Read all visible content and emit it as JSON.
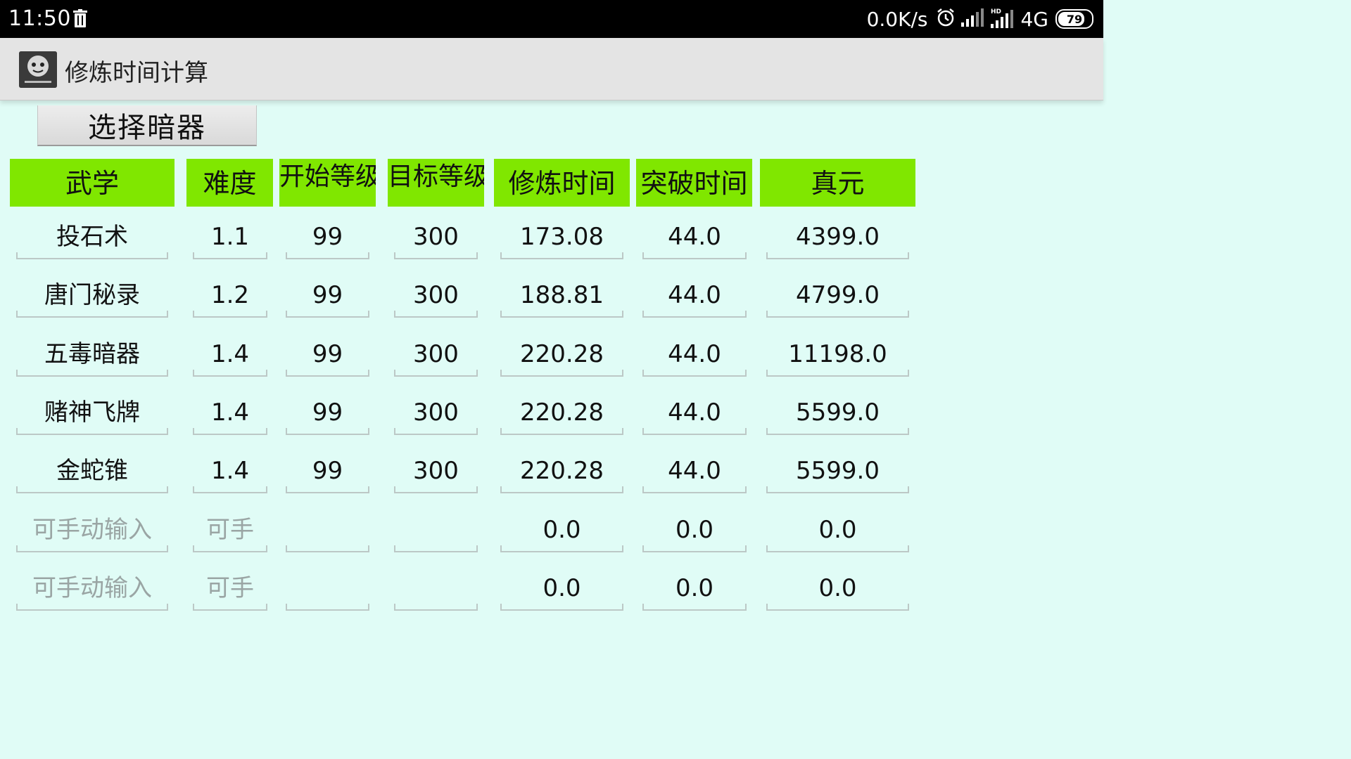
{
  "status_bar": {
    "time": "11:50",
    "net_speed": "0.0K/s",
    "network": "4G",
    "battery": "79",
    "icons": [
      "trash-icon",
      "alarm-icon",
      "signal-icon",
      "hd-signal-icon",
      "battery-icon"
    ]
  },
  "app": {
    "title": "修炼时间计算",
    "icon": "app-logo-icon"
  },
  "select_button": {
    "label": "选择暗器"
  },
  "headers": [
    "武学",
    "难度",
    "开始等级",
    "目标等级",
    "修炼时间",
    "突破时间",
    "真元"
  ],
  "rows": [
    {
      "skill": "投石术",
      "difficulty": "1.1",
      "start": "99",
      "target": "300",
      "train_time": "173.08",
      "break_time": "44.0",
      "zhenyuan": "4399.0"
    },
    {
      "skill": "唐门秘录",
      "difficulty": "1.2",
      "start": "99",
      "target": "300",
      "train_time": "188.81",
      "break_time": "44.0",
      "zhenyuan": "4799.0"
    },
    {
      "skill": "五毒暗器",
      "difficulty": "1.4",
      "start": "99",
      "target": "300",
      "train_time": "220.28",
      "break_time": "44.0",
      "zhenyuan": "11198.0"
    },
    {
      "skill": "赌神飞牌",
      "difficulty": "1.4",
      "start": "99",
      "target": "300",
      "train_time": "220.28",
      "break_time": "44.0",
      "zhenyuan": "5599.0"
    },
    {
      "skill": "金蛇锥",
      "difficulty": "1.4",
      "start": "99",
      "target": "300",
      "train_time": "220.28",
      "break_time": "44.0",
      "zhenyuan": "5599.0"
    },
    {
      "skill": "",
      "difficulty": "",
      "start": "",
      "target": "",
      "train_time": "0.0",
      "break_time": "0.0",
      "zhenyuan": "0.0"
    },
    {
      "skill": "",
      "difficulty": "",
      "start": "",
      "target": "",
      "train_time": "0.0",
      "break_time": "0.0",
      "zhenyuan": "0.0"
    }
  ],
  "placeholders": {
    "skill": "可手动输入",
    "difficulty": "可手"
  },
  "colors": {
    "header_bg": "#80e700",
    "content_bg": "#e0fcf6",
    "actionbar_bg": "#e4e4e4",
    "status_bg": "#000000",
    "hint_text": "#9aa5a4"
  }
}
